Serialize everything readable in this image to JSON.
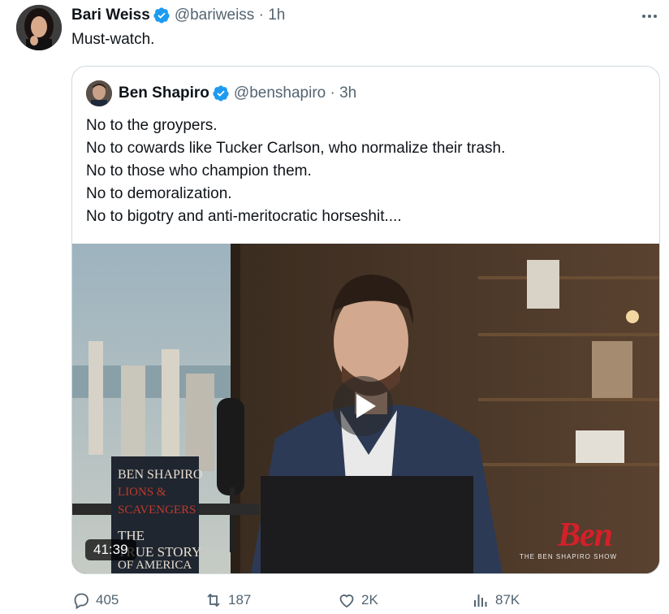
{
  "tweet": {
    "author_name": "Bari Weiss",
    "handle": "@bariweiss",
    "separator": "·",
    "time": "1h",
    "text": "Must-watch."
  },
  "quoted": {
    "author_name": "Ben Shapiro",
    "handle": "@benshapiro",
    "separator": "·",
    "time": "3h",
    "lines": [
      "No to the groypers.",
      "No to cowards like Tucker Carlson, who normalize their trash.",
      "No to those who champion them.",
      "No to demoralization.",
      "No to bigotry and anti-meritocratic horseshit...."
    ],
    "video": {
      "duration": "41:39",
      "show_logo_big": "Ben",
      "show_logo_sub": "THE   BEN   SHAPIRO   SHOW",
      "book_title_1": "BEN SHAPIRO",
      "book_title_2": "LIONS &",
      "book_title_3": "SCAVENGERS",
      "book_title_4": "THE",
      "book_title_5": "TRUE STORY",
      "book_title_6": "OF AMERICA"
    }
  },
  "actions": {
    "replies": "405",
    "reposts": "187",
    "likes": "2K",
    "views": "87K"
  },
  "colors": {
    "verified": "#1d9bf0",
    "secondary_text": "#536471",
    "border": "#cfd9de",
    "logo_red": "#d4202a"
  }
}
